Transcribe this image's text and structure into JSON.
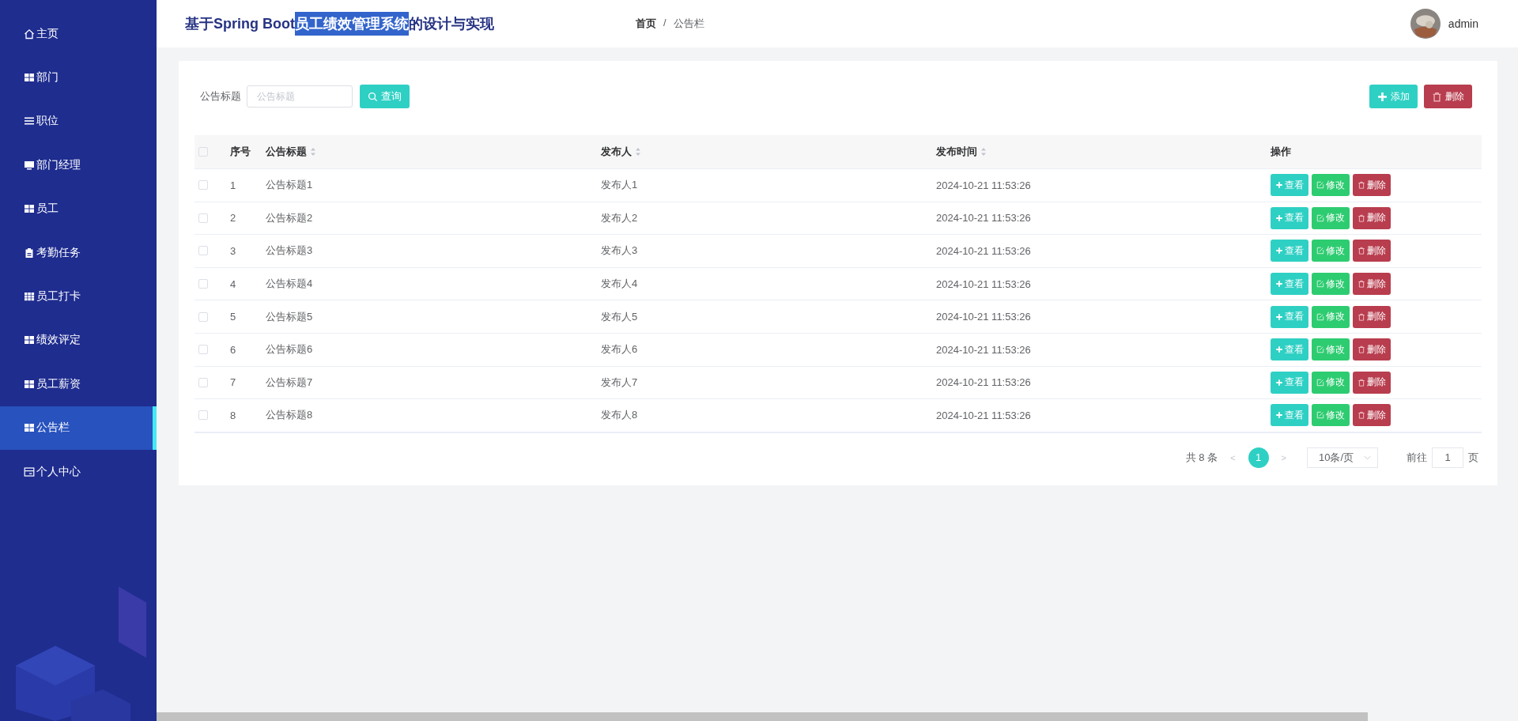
{
  "sidebar": {
    "items": [
      {
        "label": "主页",
        "selected": false
      },
      {
        "label": "部门",
        "selected": false
      },
      {
        "label": "职位",
        "selected": false
      },
      {
        "label": "部门经理",
        "selected": false
      },
      {
        "label": "员工",
        "selected": false
      },
      {
        "label": "考勤任务",
        "selected": false
      },
      {
        "label": "员工打卡",
        "selected": false
      },
      {
        "label": "绩效评定",
        "selected": false
      },
      {
        "label": "员工薪资",
        "selected": false
      },
      {
        "label": "公告栏",
        "selected": true
      },
      {
        "label": "个人中心",
        "selected": false
      }
    ]
  },
  "header": {
    "title": [
      {
        "text": "基于Spring Boot",
        "selected": false
      },
      {
        "text": "员工绩效管理系统",
        "selected": true
      },
      {
        "text": "的设计与实现",
        "selected": false
      }
    ],
    "breadcrumb": [
      "首页",
      "/",
      "公告栏"
    ],
    "user": "admin"
  },
  "search": {
    "label": "公告标题",
    "placeholder": "公告标题",
    "button": "查询"
  },
  "toolbar": [
    {
      "kind": "add",
      "label": "添加"
    },
    {
      "kind": "delete",
      "label": "删除"
    }
  ],
  "table": {
    "select_all_checked": false,
    "columns": [
      {
        "label": "序号",
        "sortable": false
      },
      {
        "label": "公告标题",
        "sortable": true
      },
      {
        "label": "发布人",
        "sortable": true
      },
      {
        "label": "发布时间",
        "sortable": true
      },
      {
        "label": "操作",
        "sortable": false
      }
    ],
    "rows": [
      {
        "checked": false,
        "cells": [
          "1",
          "公告标题1",
          "发布人1",
          "2024-10-21 11:53:26"
        ],
        "actions": [
          {
            "kind": "view",
            "label": "查看"
          },
          {
            "kind": "edit",
            "label": "修改"
          },
          {
            "kind": "delete",
            "label": "删除"
          }
        ]
      },
      {
        "checked": false,
        "cells": [
          "2",
          "公告标题2",
          "发布人2",
          "2024-10-21 11:53:26"
        ],
        "actions": [
          {
            "kind": "view",
            "label": "查看"
          },
          {
            "kind": "edit",
            "label": "修改"
          },
          {
            "kind": "delete",
            "label": "删除"
          }
        ]
      },
      {
        "checked": false,
        "cells": [
          "3",
          "公告标题3",
          "发布人3",
          "2024-10-21 11:53:26"
        ],
        "actions": [
          {
            "kind": "view",
            "label": "查看"
          },
          {
            "kind": "edit",
            "label": "修改"
          },
          {
            "kind": "delete",
            "label": "删除"
          }
        ]
      },
      {
        "checked": false,
        "cells": [
          "4",
          "公告标题4",
          "发布人4",
          "2024-10-21 11:53:26"
        ],
        "actions": [
          {
            "kind": "view",
            "label": "查看"
          },
          {
            "kind": "edit",
            "label": "修改"
          },
          {
            "kind": "delete",
            "label": "删除"
          }
        ]
      },
      {
        "checked": false,
        "cells": [
          "5",
          "公告标题5",
          "发布人5",
          "2024-10-21 11:53:26"
        ],
        "actions": [
          {
            "kind": "view",
            "label": "查看"
          },
          {
            "kind": "edit",
            "label": "修改"
          },
          {
            "kind": "delete",
            "label": "删除"
          }
        ]
      },
      {
        "checked": false,
        "cells": [
          "6",
          "公告标题6",
          "发布人6",
          "2024-10-21 11:53:26"
        ],
        "actions": [
          {
            "kind": "view",
            "label": "查看"
          },
          {
            "kind": "edit",
            "label": "修改"
          },
          {
            "kind": "delete",
            "label": "删除"
          }
        ]
      },
      {
        "checked": false,
        "cells": [
          "7",
          "公告标题7",
          "发布人7",
          "2024-10-21 11:53:26"
        ],
        "actions": [
          {
            "kind": "view",
            "label": "查看"
          },
          {
            "kind": "edit",
            "label": "修改"
          },
          {
            "kind": "delete",
            "label": "删除"
          }
        ]
      },
      {
        "checked": false,
        "cells": [
          "8",
          "公告标题8",
          "发布人8",
          "2024-10-21 11:53:26"
        ],
        "actions": [
          {
            "kind": "view",
            "label": "查看"
          },
          {
            "kind": "edit",
            "label": "修改"
          },
          {
            "kind": "delete",
            "label": "删除"
          }
        ]
      }
    ]
  },
  "pagination": {
    "total": "共 8 条",
    "prev": "<",
    "pages": [
      {
        "label": "1",
        "selected": true
      }
    ],
    "next": ">",
    "page_size": "10条/页",
    "goto_label": "前往",
    "goto_value": "1",
    "goto_suffix": "页"
  }
}
